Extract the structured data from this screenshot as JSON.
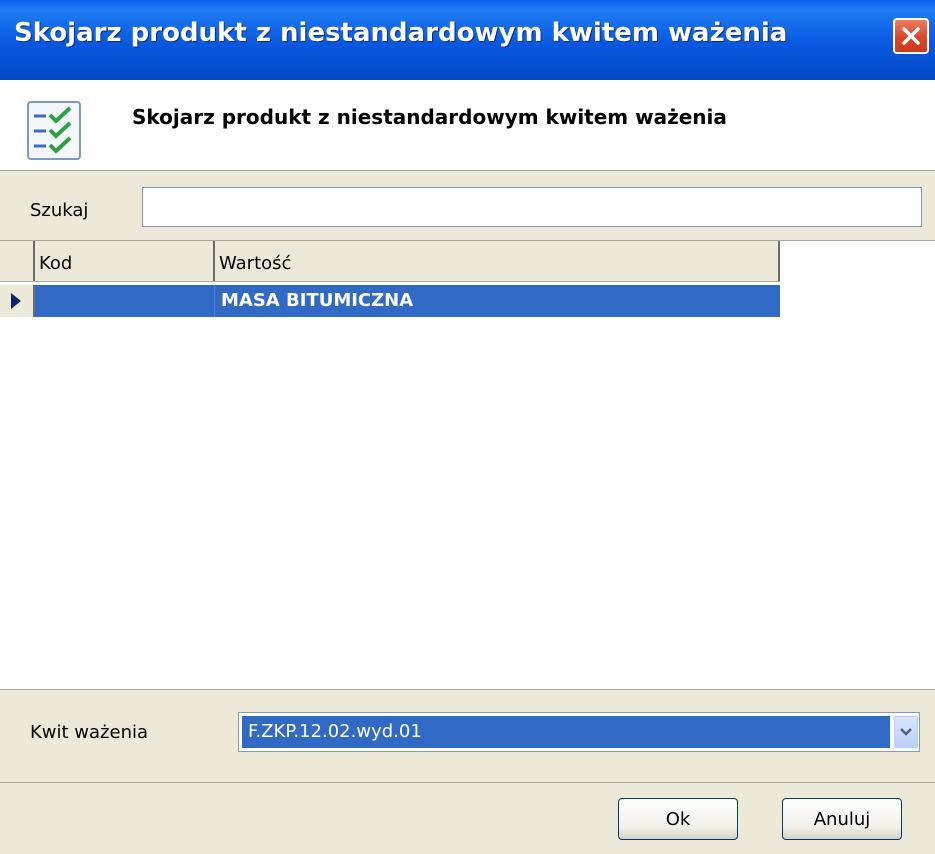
{
  "window": {
    "title": "Skojarz produkt z niestandardowym kwitem ważenia",
    "close_icon": "close-icon"
  },
  "header": {
    "icon": "checklist-icon",
    "title": "Skojarz produkt z niestandardowym kwitem ważenia"
  },
  "search": {
    "label": "Szukaj",
    "value": ""
  },
  "grid": {
    "columns": [
      "Kod",
      "Wartość"
    ],
    "rows": [
      {
        "kod": "",
        "wartosc": "MASA BITUMICZNA",
        "selected": true
      }
    ]
  },
  "kwit": {
    "label": "Kwit ważenia",
    "selected": "F.ZKP.12.02.wyd.01"
  },
  "buttons": {
    "ok": "Ok",
    "cancel": "Anuluj"
  },
  "colors": {
    "title_bar": "#0858df",
    "selection": "#316ac5",
    "close_button": "#d9482a",
    "dialog_bg": "#ece9d8"
  }
}
